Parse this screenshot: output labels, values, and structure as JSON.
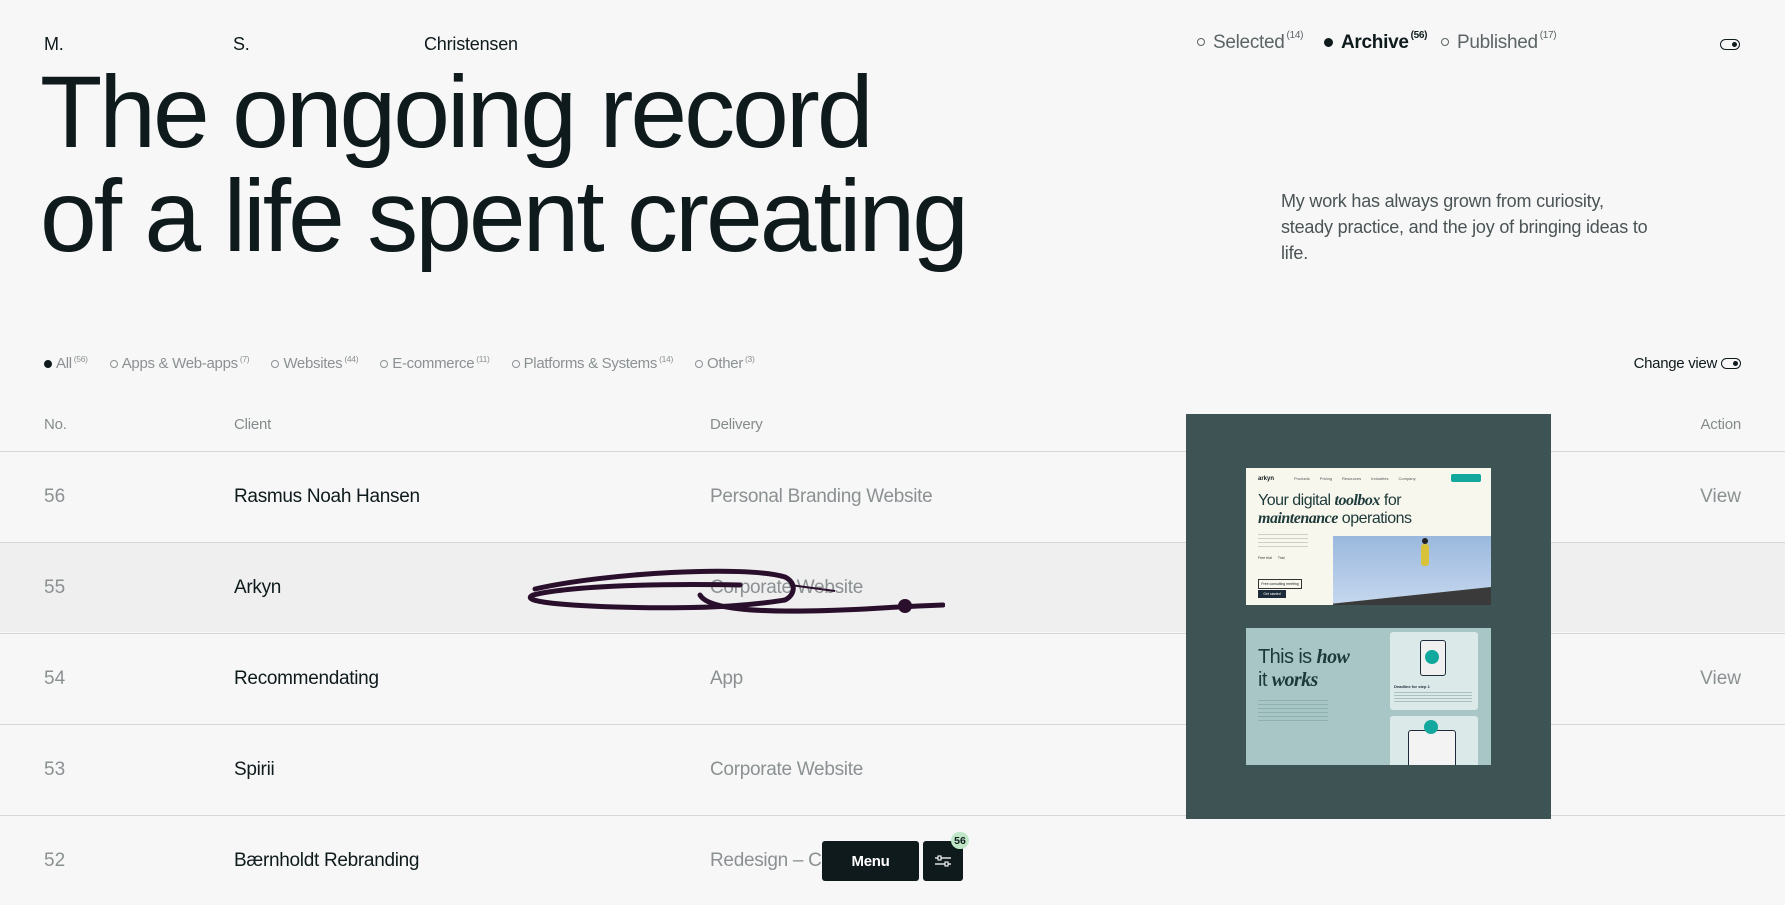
{
  "header": {
    "name_parts": [
      "M.",
      "S.",
      "Christensen"
    ],
    "nav": [
      {
        "label": "Selected",
        "count": "(14)",
        "active": false
      },
      {
        "label": "Archive",
        "count": "(56)",
        "active": true
      },
      {
        "label": "Published",
        "count": "(17)",
        "active": false
      }
    ]
  },
  "hero": {
    "line1": "The ongoing record",
    "line2": "of a life spent creating"
  },
  "intro": "My work has always grown from curiosity, steady practice, and the joy of bringing ideas to life.",
  "filters": [
    {
      "label": "All",
      "count": "(56)",
      "active": true
    },
    {
      "label": "Apps & Web-apps",
      "count": "(7)",
      "active": false
    },
    {
      "label": "Websites",
      "count": "(44)",
      "active": false
    },
    {
      "label": "E-commerce",
      "count": "(11)",
      "active": false
    },
    {
      "label": "Platforms & Systems",
      "count": "(14)",
      "active": false
    },
    {
      "label": "Other",
      "count": "(3)",
      "active": false
    }
  ],
  "change_view": "Change view",
  "table": {
    "headers": {
      "no": "No.",
      "client": "Client",
      "delivery": "Delivery",
      "action": "Action"
    },
    "rows": [
      {
        "no": "56",
        "client": "Rasmus Noah Hansen",
        "delivery": "Personal Branding Website",
        "action": "View"
      },
      {
        "no": "55",
        "client": "Arkyn",
        "delivery": "Corporate Website",
        "action": ""
      },
      {
        "no": "54",
        "client": "Recommendating",
        "delivery": "App",
        "action": "View"
      },
      {
        "no": "53",
        "client": "Spirii",
        "delivery": "Corporate Website",
        "action": ""
      },
      {
        "no": "52",
        "client": "Bærnholdt Rebranding",
        "delivery": "Redesign – Co",
        "action": ""
      }
    ]
  },
  "preview": {
    "shot1": {
      "brand": "arkyn",
      "nav_items": [
        "Products",
        "Pricing",
        "Resources",
        "Industries",
        "Company"
      ],
      "headline_a": "Your digital ",
      "headline_b": "toolbox",
      "headline_c": " for",
      "headline_d": "maintenance",
      "headline_e": " operations",
      "check1": "Free trial",
      "check2": "Trial",
      "btn1": "Free consulting meeting",
      "btn2": "Get started"
    },
    "shot2": {
      "headline_a": "This is ",
      "headline_b": "how",
      "headline_c": "it ",
      "headline_d": "works",
      "card_title": "Deadline for step 1"
    },
    "colors": {
      "panel": "#3e5354",
      "accent": "#13a89e",
      "scribble": "#2a0f2d"
    }
  },
  "bottom": {
    "menu_label": "Menu",
    "filter_icon": "sliders-icon",
    "badge": "56"
  }
}
